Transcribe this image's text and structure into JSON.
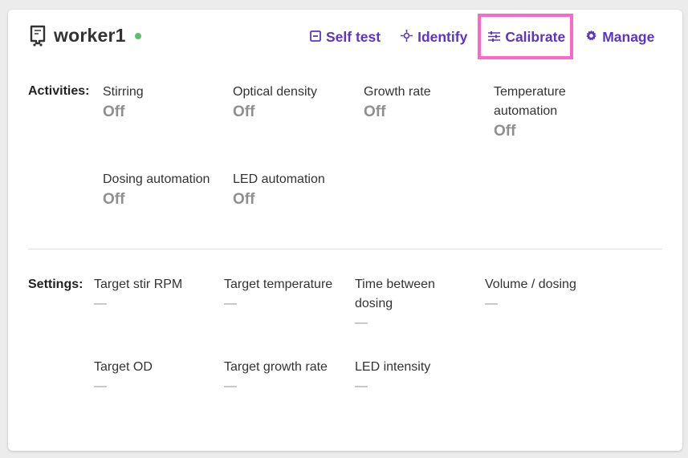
{
  "colors": {
    "accent": "#5b35c7",
    "status_online": "#5cbf69",
    "highlight": "#ff66cc",
    "value_gray": "#8f8f8f"
  },
  "header": {
    "title": "worker1",
    "title_icon": "rpi-board-icon",
    "status": "online",
    "actions": [
      {
        "label": "Self test",
        "icon": "checkbox-minus-icon"
      },
      {
        "label": "Identify",
        "icon": "crosshair-icon"
      },
      {
        "label": "Calibrate",
        "icon": "tune-sliders-icon"
      },
      {
        "label": "Manage",
        "icon": "gear-icon"
      }
    ]
  },
  "activities": {
    "label": "Activities:",
    "items": [
      {
        "label": "Stirring",
        "value": "Off"
      },
      {
        "label": "Optical density",
        "value": "Off"
      },
      {
        "label": "Growth rate",
        "value": "Off"
      },
      {
        "label": "Temperature automation",
        "value": "Off"
      },
      {
        "label": "Dosing automation",
        "value": "Off"
      },
      {
        "label": "LED automation",
        "value": "Off"
      }
    ]
  },
  "settings": {
    "label": "Settings:",
    "items": [
      {
        "label": "Target stir RPM",
        "value": "—"
      },
      {
        "label": "Target temperature",
        "value": "—"
      },
      {
        "label": "Time between dosing",
        "value": "—"
      },
      {
        "label": "Volume / dosing",
        "value": "—"
      },
      {
        "label": "Target OD",
        "value": "—"
      },
      {
        "label": "Target growth rate",
        "value": "—"
      },
      {
        "label": "LED intensity",
        "value": "—"
      }
    ]
  }
}
